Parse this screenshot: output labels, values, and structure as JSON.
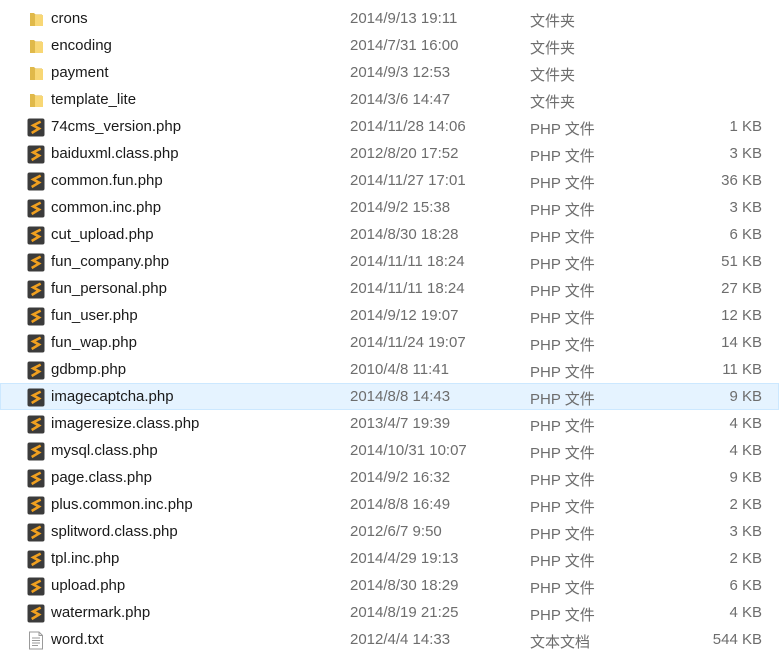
{
  "files": [
    {
      "name": "crons",
      "date": "2014/9/13 19:11",
      "type": "文件夹",
      "size": "",
      "icon": "folder-icon"
    },
    {
      "name": "encoding",
      "date": "2014/7/31 16:00",
      "type": "文件夹",
      "size": "",
      "icon": "folder-icon"
    },
    {
      "name": "payment",
      "date": "2014/9/3 12:53",
      "type": "文件夹",
      "size": "",
      "icon": "folder-icon"
    },
    {
      "name": "template_lite",
      "date": "2014/3/6 14:47",
      "type": "文件夹",
      "size": "",
      "icon": "folder-icon"
    },
    {
      "name": "74cms_version.php",
      "date": "2014/11/28 14:06",
      "type": "PHP 文件",
      "size": "1 KB",
      "icon": "php-file-icon"
    },
    {
      "name": "baiduxml.class.php",
      "date": "2012/8/20 17:52",
      "type": "PHP 文件",
      "size": "3 KB",
      "icon": "php-file-icon"
    },
    {
      "name": "common.fun.php",
      "date": "2014/11/27 17:01",
      "type": "PHP 文件",
      "size": "36 KB",
      "icon": "php-file-icon"
    },
    {
      "name": "common.inc.php",
      "date": "2014/9/2 15:38",
      "type": "PHP 文件",
      "size": "3 KB",
      "icon": "php-file-icon"
    },
    {
      "name": "cut_upload.php",
      "date": "2014/8/30 18:28",
      "type": "PHP 文件",
      "size": "6 KB",
      "icon": "php-file-icon"
    },
    {
      "name": "fun_company.php",
      "date": "2014/11/11 18:24",
      "type": "PHP 文件",
      "size": "51 KB",
      "icon": "php-file-icon"
    },
    {
      "name": "fun_personal.php",
      "date": "2014/11/11 18:24",
      "type": "PHP 文件",
      "size": "27 KB",
      "icon": "php-file-icon"
    },
    {
      "name": "fun_user.php",
      "date": "2014/9/12 19:07",
      "type": "PHP 文件",
      "size": "12 KB",
      "icon": "php-file-icon"
    },
    {
      "name": "fun_wap.php",
      "date": "2014/11/24 19:07",
      "type": "PHP 文件",
      "size": "14 KB",
      "icon": "php-file-icon"
    },
    {
      "name": "gdbmp.php",
      "date": "2010/4/8 11:41",
      "type": "PHP 文件",
      "size": "11 KB",
      "icon": "php-file-icon"
    },
    {
      "name": "imagecaptcha.php",
      "date": "2014/8/8 14:43",
      "type": "PHP 文件",
      "size": "9 KB",
      "icon": "php-file-icon",
      "selected": true
    },
    {
      "name": "imageresize.class.php",
      "date": "2013/4/7 19:39",
      "type": "PHP 文件",
      "size": "4 KB",
      "icon": "php-file-icon"
    },
    {
      "name": "mysql.class.php",
      "date": "2014/10/31 10:07",
      "type": "PHP 文件",
      "size": "4 KB",
      "icon": "php-file-icon"
    },
    {
      "name": "page.class.php",
      "date": "2014/9/2 16:32",
      "type": "PHP 文件",
      "size": "9 KB",
      "icon": "php-file-icon"
    },
    {
      "name": "plus.common.inc.php",
      "date": "2014/8/8 16:49",
      "type": "PHP 文件",
      "size": "2 KB",
      "icon": "php-file-icon"
    },
    {
      "name": "splitword.class.php",
      "date": "2012/6/7 9:50",
      "type": "PHP 文件",
      "size": "3 KB",
      "icon": "php-file-icon"
    },
    {
      "name": "tpl.inc.php",
      "date": "2014/4/29 19:13",
      "type": "PHP 文件",
      "size": "2 KB",
      "icon": "php-file-icon"
    },
    {
      "name": "upload.php",
      "date": "2014/8/30 18:29",
      "type": "PHP 文件",
      "size": "6 KB",
      "icon": "php-file-icon"
    },
    {
      "name": "watermark.php",
      "date": "2014/8/19 21:25",
      "type": "PHP 文件",
      "size": "4 KB",
      "icon": "php-file-icon"
    },
    {
      "name": "word.txt",
      "date": "2012/4/4 14:33",
      "type": "文本文档",
      "size": "544 KB",
      "icon": "text-file-icon"
    }
  ],
  "colors": {
    "selection_bg": "#e5f3ff",
    "folder": "#f8d775",
    "php_icon_bg": "#3b3b3b",
    "php_icon_glyph": "#f0a020"
  }
}
